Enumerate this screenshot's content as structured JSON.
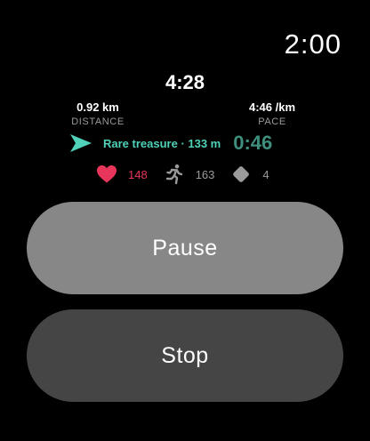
{
  "status_bar": {
    "time": "2:00"
  },
  "workout": {
    "elapsed": "4:28",
    "distance": {
      "value": "0.92 km",
      "label": "DISTANCE"
    },
    "pace": {
      "value": "4:46 /km",
      "label": "PACE"
    },
    "treasure": {
      "text": "Rare treasure · 133 m",
      "countdown": "0:46"
    },
    "metrics": {
      "heart_rate": "148",
      "steps": "163",
      "gems": "4"
    }
  },
  "actions": {
    "pause_label": "Pause",
    "stop_label": "Stop"
  },
  "colors": {
    "accent_teal": "#4fd2b7",
    "countdown_teal": "#3e8f7d",
    "heart_red": "#e8365a",
    "pause_bg": "#878787",
    "stop_bg": "#454545"
  }
}
